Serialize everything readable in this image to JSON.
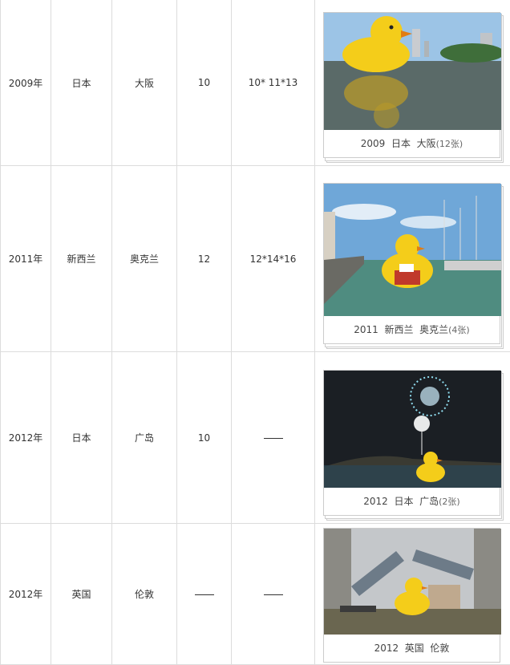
{
  "rows": [
    {
      "year": "2009年",
      "country": "日本",
      "city": "大阪",
      "height": "10",
      "dims": "10* 11*13",
      "caption": {
        "year": "2009",
        "country": "日本",
        "city": "大阪",
        "count": "(12张)"
      },
      "photo_icon": "duck-harbor-photo"
    },
    {
      "year": "2011年",
      "country": "新西兰",
      "city": "奥克兰",
      "height": "12",
      "dims": "12*14*16",
      "caption": {
        "year": "2011",
        "country": "新西兰",
        "city": "奥克兰",
        "count": "(4张)"
      },
      "photo_icon": "duck-marina-photo"
    },
    {
      "year": "2012年",
      "country": "日本",
      "city": "广岛",
      "height": "10",
      "dims": "—",
      "caption": {
        "year": "2012",
        "country": "日本",
        "city": "广岛",
        "count": "(2张)"
      },
      "photo_icon": "duck-fireworks-photo"
    },
    {
      "year": "2012年",
      "country": "英国",
      "city": "伦敦",
      "height": "—",
      "dims": "—",
      "caption": {
        "year": "2012",
        "country": "英国",
        "city": "伦敦",
        "count": ""
      },
      "photo_icon": "duck-towerbridge-photo"
    }
  ],
  "colors": {
    "duck": "#f7d21c",
    "border": "#dcdcdc"
  }
}
